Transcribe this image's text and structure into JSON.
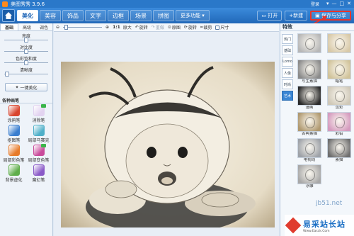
{
  "app": {
    "title": "美图秀秀 3.9.6"
  },
  "titlebar": {
    "login": "登录",
    "controls": [
      "▾",
      "—",
      "□",
      "✕"
    ]
  },
  "tabs": [
    {
      "label": "美化",
      "active": true
    },
    {
      "label": "美容"
    },
    {
      "label": "饰品"
    },
    {
      "label": "文字"
    },
    {
      "label": "边框"
    },
    {
      "label": "场景"
    },
    {
      "label": "拼图"
    },
    {
      "label": "更多功能 ▾"
    }
  ],
  "right_actions": {
    "open": "打开",
    "new": "+新建",
    "save": "保存与分享"
  },
  "left_panel": {
    "subtabs": [
      "基础",
      "高级",
      "调色"
    ],
    "sliders": [
      {
        "label": "亮度",
        "value": 0.5
      },
      {
        "label": "对比度",
        "value": 0.5
      },
      {
        "label": "色彩饱和度",
        "value": 0.5
      },
      {
        "label": "清晰度",
        "value": 0.05
      }
    ],
    "onekey_button": "一键美化",
    "brushes_title": "各种画笔",
    "brushes": [
      {
        "label": "涂鸦笔",
        "color": "#d9452e"
      },
      {
        "label": "消除笔",
        "color": "#e2d3f0"
      },
      {
        "label": "抠图笔",
        "color": "#3a7ecf"
      },
      {
        "label": "局部马赛克",
        "color": "#4fb0c9"
      },
      {
        "label": "局部彩色笔",
        "color": "#e77b2a"
      },
      {
        "label": "局部变色笔",
        "color": "#c94b9b"
      },
      {
        "label": "背景虚化",
        "color": "#5fae4a"
      },
      {
        "label": "魔幻笔",
        "color": "#8a5ac8"
      }
    ]
  },
  "toolbar": {
    "zoom_label": "1:1",
    "original_size": "原大",
    "rotate": "旋转",
    "redo": "重做",
    "reset": "原图",
    "spin": "旋转",
    "crop": "裁剪",
    "size": "尺寸"
  },
  "right_panel": {
    "title": "特效",
    "categories": [
      {
        "label": "热门"
      },
      {
        "label": "基础"
      },
      {
        "label": "Lomo"
      },
      {
        "label": "人像"
      },
      {
        "label": "时尚"
      },
      {
        "label": "艺术",
        "active": true
      }
    ],
    "effects": [
      {
        "label": "",
        "tone": "#b7b7b7"
      },
      {
        "label": "",
        "tone": "#d8c9a8"
      },
      {
        "label": "写生素描",
        "tone": "#8a8a8a"
      },
      {
        "label": "蜡笔",
        "tone": "#d1c39a"
      },
      {
        "label": "漫画",
        "tone": "#2a2a2a"
      },
      {
        "label": "淡彩",
        "tone": "#cfc8b8"
      },
      {
        "label": "古典素描",
        "tone": "#b09970"
      },
      {
        "label": "彩铅",
        "tone": "#d59bbf"
      },
      {
        "label": "电视线",
        "tone": "#9ea2a8"
      },
      {
        "label": "素描",
        "tone": "#6e6e6e"
      },
      {
        "label": "浮雕",
        "tone": "#a8a8a8"
      }
    ]
  },
  "watermark": {
    "site": "jb51.net",
    "brand": "易采站长站",
    "url": "Www.Easck.Com"
  }
}
